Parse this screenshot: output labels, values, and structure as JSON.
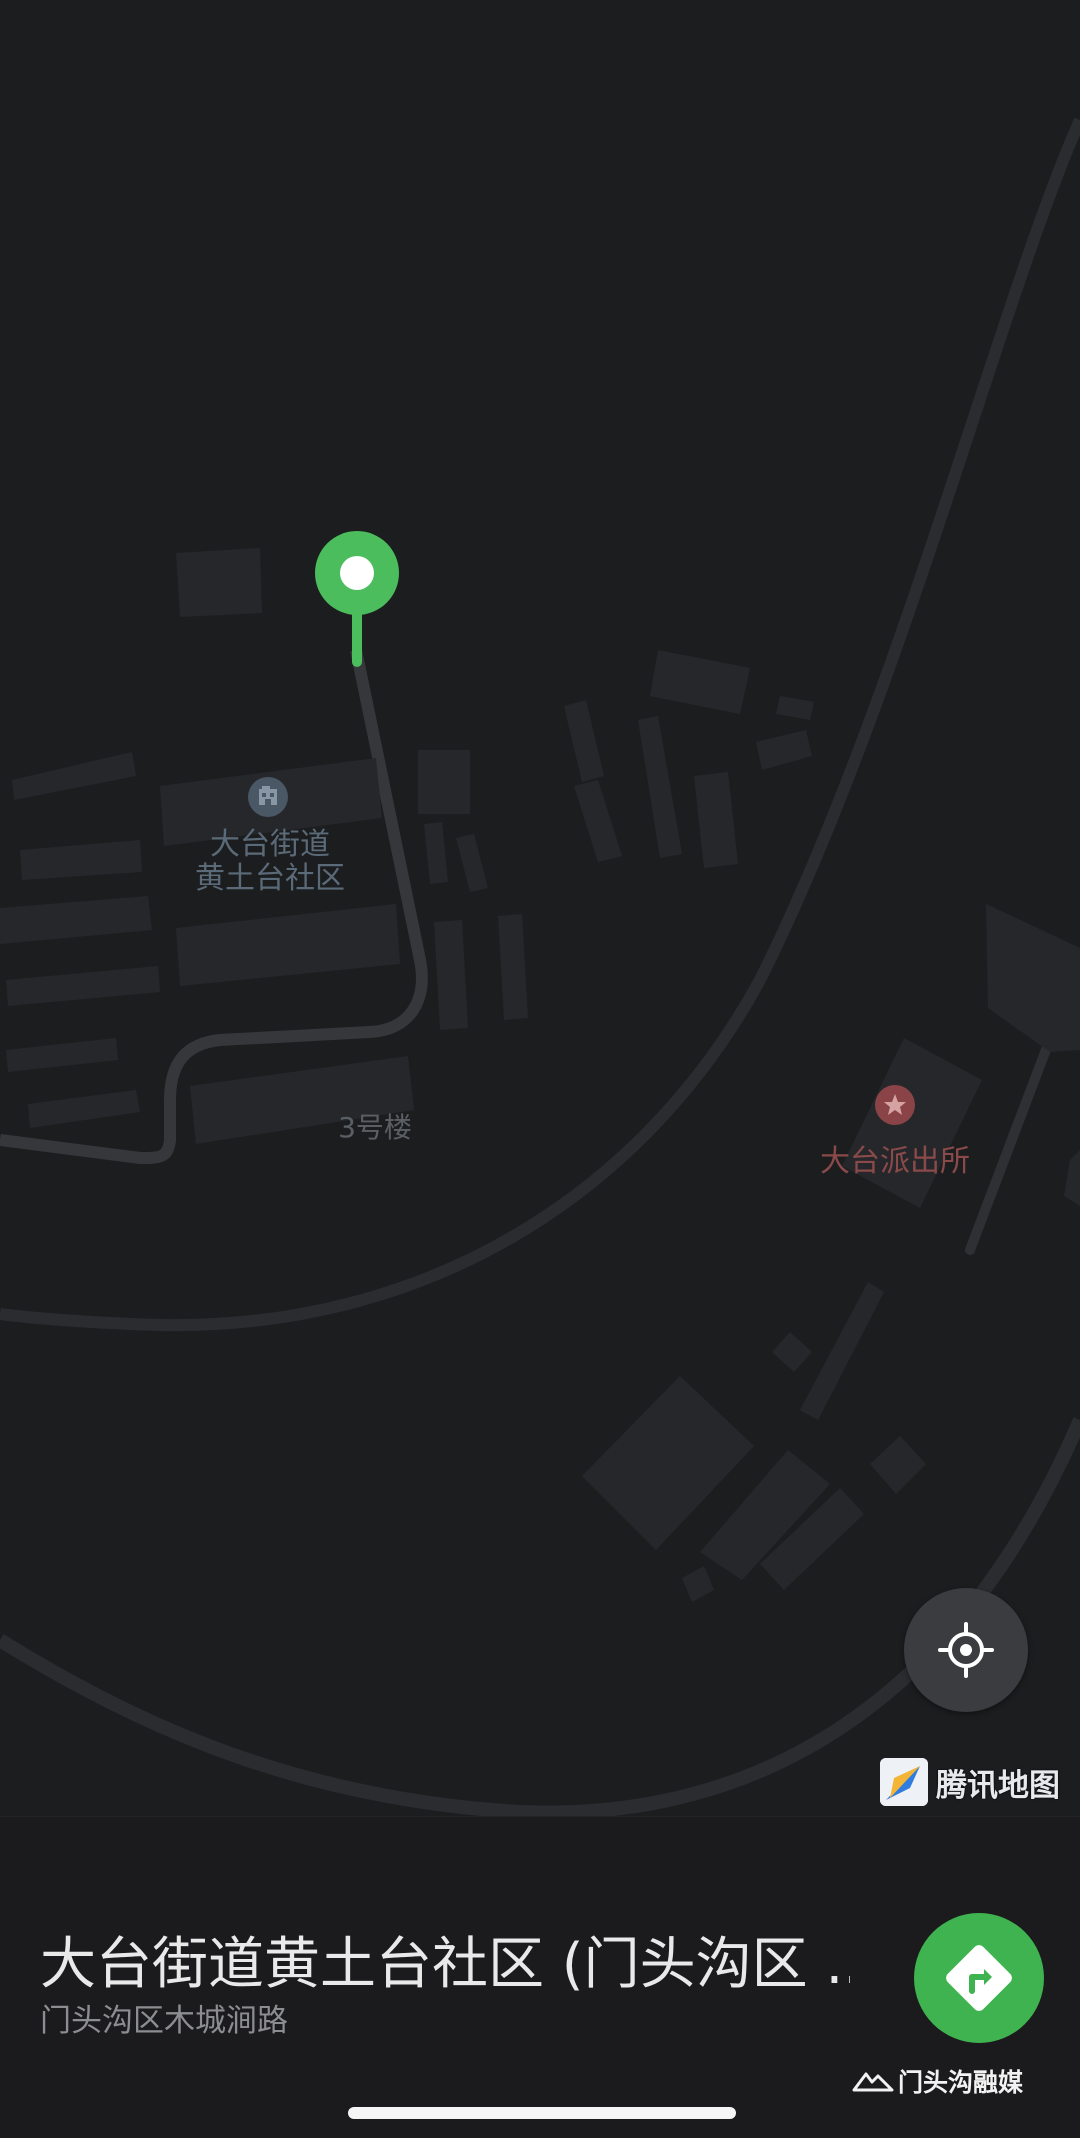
{
  "map": {
    "provider_label": "腾讯地图",
    "labels": {
      "community_line1": "大台街道",
      "community_line2": "黄土台社区",
      "building": "3号楼",
      "police_station": "大台派出所"
    },
    "colors": {
      "background": "#1c1d1f",
      "building_block": "#25272a",
      "road": "#2e3034",
      "route": "#35373b",
      "pin": "#4cbd5c",
      "police_label": "#8a4a4a",
      "community_label": "#5b6a78"
    },
    "icons": [
      "building-poi-icon",
      "police-poi-icon",
      "location-pin-icon",
      "locate-me-icon"
    ]
  },
  "place": {
    "title": "大台街道黄土台社区 (门头沟区 ...",
    "address": "门头沟区木城涧路"
  },
  "actions": {
    "navigate_icon": "navigate-arrow-icon",
    "navigate_color": "#3fb34f"
  },
  "watermark": {
    "text": "门头沟融媒"
  }
}
